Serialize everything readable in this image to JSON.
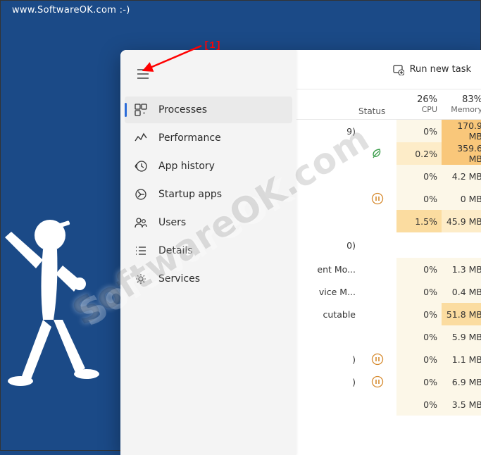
{
  "page_url": "www.SoftwareOK.com :-)",
  "watermark": "SoftwareOK.com",
  "annotation_label": "[1]",
  "sidebar": {
    "items": [
      {
        "label": "Processes",
        "selected": true
      },
      {
        "label": "Performance",
        "selected": false
      },
      {
        "label": "App history",
        "selected": false
      },
      {
        "label": "Startup apps",
        "selected": false
      },
      {
        "label": "Users",
        "selected": false
      },
      {
        "label": "Details",
        "selected": false
      },
      {
        "label": "Services",
        "selected": false
      }
    ]
  },
  "toolbar": {
    "run_new_task": "Run new task"
  },
  "columns": {
    "status": "Status",
    "cpu_pct": "26%",
    "cpu_label": "CPU",
    "mem_pct": "83%",
    "mem_label": "Memory"
  },
  "rows": [
    {
      "name": "9)",
      "status": "",
      "cpu": "0%",
      "mem": "170.9 MB",
      "cpu_heat": 0,
      "mem_heat": 3
    },
    {
      "name": "",
      "status": "leaf",
      "cpu": "0.2%",
      "mem": "359.6 MB",
      "cpu_heat": 1,
      "mem_heat": 3
    },
    {
      "name": "",
      "status": "",
      "cpu": "0%",
      "mem": "4.2 MB",
      "cpu_heat": 0,
      "mem_heat": 0
    },
    {
      "name": "",
      "status": "pause",
      "cpu": "0%",
      "mem": "0 MB",
      "cpu_heat": 0,
      "mem_heat": 0
    },
    {
      "name": "",
      "status": "",
      "cpu": "1.5%",
      "mem": "45.9 MB",
      "cpu_heat": 2,
      "mem_heat": 1
    },
    {
      "gap": true,
      "name": "0)"
    },
    {
      "name": "ent Mo...",
      "status": "",
      "cpu": "0%",
      "mem": "1.3 MB",
      "cpu_heat": 0,
      "mem_heat": 0
    },
    {
      "name": "vice M...",
      "status": "",
      "cpu": "0%",
      "mem": "0.4 MB",
      "cpu_heat": 0,
      "mem_heat": 0
    },
    {
      "name": "cutable",
      "status": "",
      "cpu": "0%",
      "mem": "51.8 MB",
      "cpu_heat": 0,
      "mem_heat": 2
    },
    {
      "name": "",
      "status": "",
      "cpu": "0%",
      "mem": "5.9 MB",
      "cpu_heat": 0,
      "mem_heat": 0
    },
    {
      "name": ")",
      "status": "pause",
      "cpu": "0%",
      "mem": "1.1 MB",
      "cpu_heat": 0,
      "mem_heat": 0
    },
    {
      "name": ")",
      "status": "pause",
      "cpu": "0%",
      "mem": "6.9 MB",
      "cpu_heat": 0,
      "mem_heat": 0
    },
    {
      "name": "",
      "status": "",
      "cpu": "0%",
      "mem": "3.5 MB",
      "cpu_heat": 0,
      "mem_heat": 0
    }
  ]
}
